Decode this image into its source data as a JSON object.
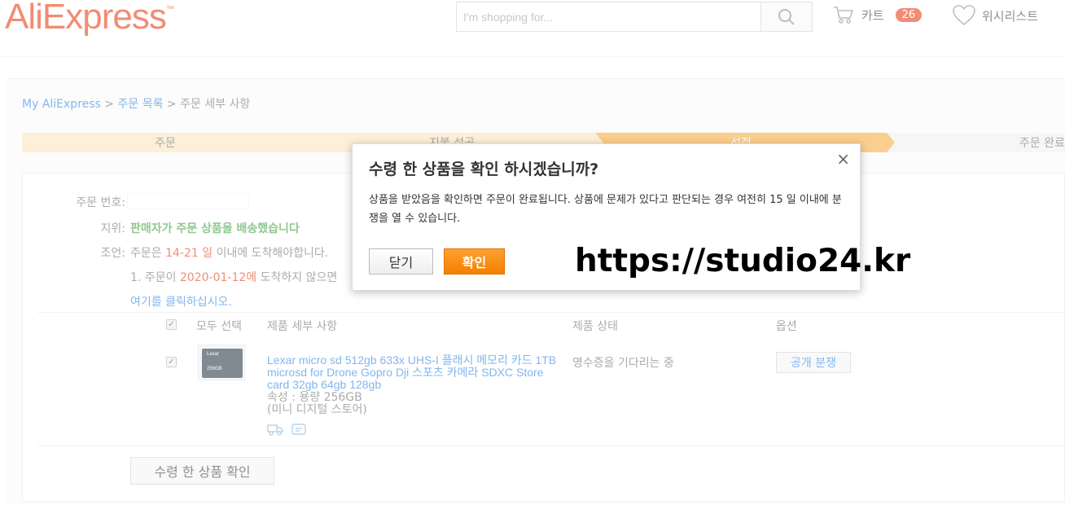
{
  "header": {
    "logo": "AliExpress",
    "logo_tm": "™",
    "search_placeholder": "I'm shopping for...",
    "cart_label": "카트",
    "cart_count": "26",
    "wishlist_label": "위시리스트",
    "brand_color": "#e62e04"
  },
  "breadcrumb": {
    "home": "My AliExpress",
    "sep1": ">",
    "orders": "주문 목록",
    "sep2": ">",
    "current": "주문 세부 사항"
  },
  "steps": [
    {
      "label": "주문"
    },
    {
      "label": "지불 성공"
    },
    {
      "label": "선적"
    },
    {
      "label": "주문 완료"
    }
  ],
  "order": {
    "order_no_label": "주문 번호:",
    "status_label": "지위:",
    "status_value": "판매자가 주문 상품을 배송했습니다",
    "condition_label": "조언:",
    "condition_prefix": "주문은",
    "condition_days": "14-21 일",
    "condition_suffix": "이내에 도착해야합니다.",
    "cond2_prefix": "1. 주문이",
    "cond2_date": "2020-01-12에",
    "cond2_suffix": "도착하지 않으면",
    "cond3": "여기를 클릭하십시오."
  },
  "table": {
    "select_all": "모두 선택",
    "col_details": "제품 세부 사항",
    "col_status": "제품 상태",
    "col_options": "옵션"
  },
  "product": {
    "title": "Lexar micro sd 512gb 633x UHS-I 플래시 메모리 카드 1TB microsd for Drone Gopro Dji 스포츠 카메라 SDXC Store card 32gb 64gb 128gb",
    "attribute": "속성 : 용량 256GB",
    "store": "(미니 디지털 스토어)",
    "status": "영수증을 기다리는 중",
    "dispute_button": "공개 분쟁",
    "card_brand": "Lexar",
    "card_size": "256GB"
  },
  "confirm_goods_button": "수령 한 상품 확인",
  "modal": {
    "title": "수령 한 상품을 확인 하시겠습니까?",
    "close_icon": "×",
    "body": "상품을 받았음을 확인하면 주문이 완료됩니다. 상품에 문제가 있다고 판단되는 경우 여전히 15 일 이내에 분쟁을 열 수 있습니다.",
    "cancel_label": "닫기",
    "confirm_label": "확인"
  },
  "watermark": "https://studio24.kr"
}
